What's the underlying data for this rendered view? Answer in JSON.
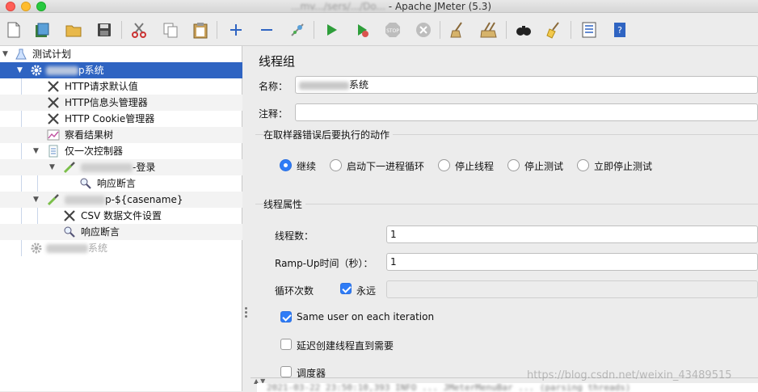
{
  "window": {
    "title_visible": "Apache JMeter (5.3)",
    "title_prefix_blurred": "...mv.../sers/.../Do..."
  },
  "toolbar": {
    "buttons": [
      {
        "name": "new-icon"
      },
      {
        "name": "templates-icon"
      },
      {
        "name": "open-icon"
      },
      {
        "name": "save-icon"
      },
      {
        "name": "cut-icon"
      },
      {
        "name": "copy-icon"
      },
      {
        "name": "paste-icon"
      },
      {
        "name": "expand-icon"
      },
      {
        "name": "collapse-icon"
      },
      {
        "name": "toggle-icon"
      },
      {
        "name": "start-icon"
      },
      {
        "name": "start-no-pause-icon"
      },
      {
        "name": "stop-icon"
      },
      {
        "name": "shutdown-icon"
      },
      {
        "name": "clear-icon"
      },
      {
        "name": "clear-all-icon"
      },
      {
        "name": "search-icon"
      },
      {
        "name": "reset-search-icon"
      },
      {
        "name": "function-helper-icon"
      },
      {
        "name": "help-icon"
      }
    ]
  },
  "tree": {
    "items": [
      {
        "label": "测试计划"
      },
      {
        "label": "p系统"
      },
      {
        "label": "HTTP请求默认值"
      },
      {
        "label": "HTTP信息头管理器"
      },
      {
        "label": "HTTP Cookie管理器"
      },
      {
        "label": "察看结果树"
      },
      {
        "label": "仅一次控制器"
      },
      {
        "label": "-登录"
      },
      {
        "label": "响应断言"
      },
      {
        "label": "p-${casename}"
      },
      {
        "label": "CSV 数据文件设置"
      },
      {
        "label": "响应断言"
      },
      {
        "label": "系统"
      }
    ]
  },
  "panel": {
    "title": "线程组",
    "name_label": "名称：",
    "name_value_suffix": "系统",
    "comment_label": "注释：",
    "comment_value": "",
    "error_group_title": "在取样器错误后要执行的动作",
    "error_actions": [
      {
        "label": "继续",
        "selected": true
      },
      {
        "label": "启动下一进程循环",
        "selected": false
      },
      {
        "label": "停止线程",
        "selected": false
      },
      {
        "label": "停止测试",
        "selected": false
      },
      {
        "label": "立即停止测试",
        "selected": false
      }
    ],
    "props_group_title": "线程属性",
    "threads_label": "线程数：",
    "threads_value": "1",
    "rampup_label": "Ramp-Up时间（秒）：",
    "rampup_value": "1",
    "loop_label": "循环次数",
    "forever_label": "永远",
    "forever_checked": true,
    "loop_value": "",
    "same_user_label": "Same user on each iteration",
    "same_user_checked": true,
    "delay_label": "延迟创建线程直到需要",
    "delay_checked": false,
    "scheduler_label": "调度器",
    "scheduler_checked": false
  },
  "log": {
    "line_visible": "2021-03-22 23:50:10,393 INFO ... JMeterMenuBar ... (parsing threads)",
    "watermark": "https://blog.csdn.net/weixin_43489515"
  },
  "colors": {
    "selection": "#2f64c2",
    "accent": "#2f7cf6"
  }
}
